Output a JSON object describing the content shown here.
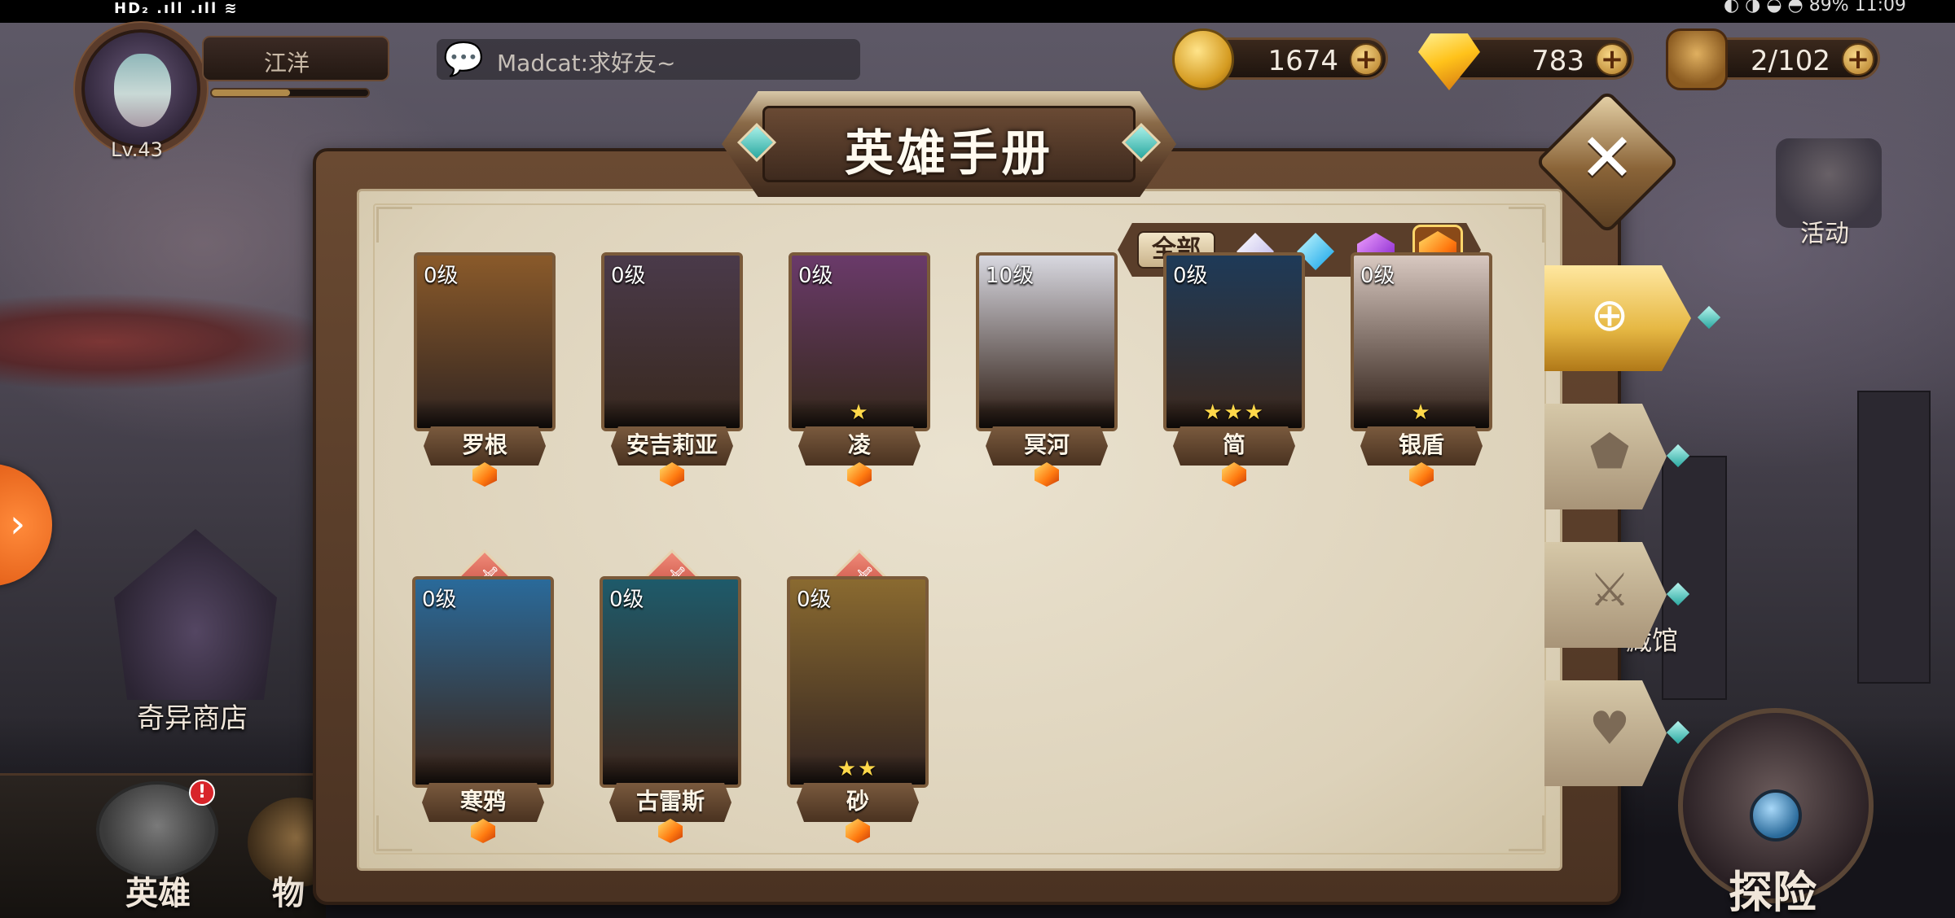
{
  "status_bar": {
    "left": "HD₂ .ıll .ıll ≋",
    "right": "◐ ◑ ◒ ◓ 89%  11:09"
  },
  "player": {
    "name": "江洋",
    "level": "Lv.43",
    "exp_fraction": 0.5
  },
  "chat": {
    "text": "Madcat:求好友~"
  },
  "currencies": {
    "gold": "1674",
    "gems": "783",
    "bag": "2/102"
  },
  "left_menu": {
    "shop_label": "奇异商店",
    "hero_label": "英雄",
    "hero_badge": "!",
    "item_label": "物"
  },
  "right_menu": {
    "activity_label": "活动",
    "museum_label": "藏馆",
    "explore_label": "探险"
  },
  "dialog": {
    "title": "英雄手册",
    "close": "✕"
  },
  "filters": {
    "all_label": "全部",
    "rarities": [
      "white",
      "blue",
      "purple",
      "orange"
    ],
    "selected": "orange"
  },
  "side_tabs": [
    {
      "name": "all",
      "icon": "grid-icon",
      "active": true
    },
    {
      "name": "defense",
      "icon": "shield-icon",
      "active": false
    },
    {
      "name": "attack",
      "icon": "sword-icon",
      "active": false
    },
    {
      "name": "support",
      "icon": "heart-icon",
      "active": false
    }
  ],
  "heroes_row1": [
    {
      "level": "0级",
      "name": "罗根",
      "stars": ""
    },
    {
      "level": "0级",
      "name": "安吉莉亚",
      "stars": ""
    },
    {
      "level": "0级",
      "name": "凌",
      "stars": "★"
    },
    {
      "level": "10级",
      "name": "冥河",
      "stars": ""
    },
    {
      "level": "0级",
      "name": "简",
      "stars": "★★★"
    },
    {
      "level": "0级",
      "name": "银盾",
      "stars": "★"
    }
  ],
  "heroes_row2": [
    {
      "level": "0级",
      "name": "寒鸦",
      "stars": ""
    },
    {
      "level": "0级",
      "name": "古雷斯",
      "stars": ""
    },
    {
      "level": "0级",
      "name": "砂",
      "stars": "★★"
    }
  ],
  "colors": {
    "frame": "#4a3222",
    "paper": "#e6dcc6",
    "accent_gold": "#e6b844",
    "rank_orange": "#ff7a10",
    "weapon_tag": "#b83a30",
    "star": "#ffd84a"
  }
}
